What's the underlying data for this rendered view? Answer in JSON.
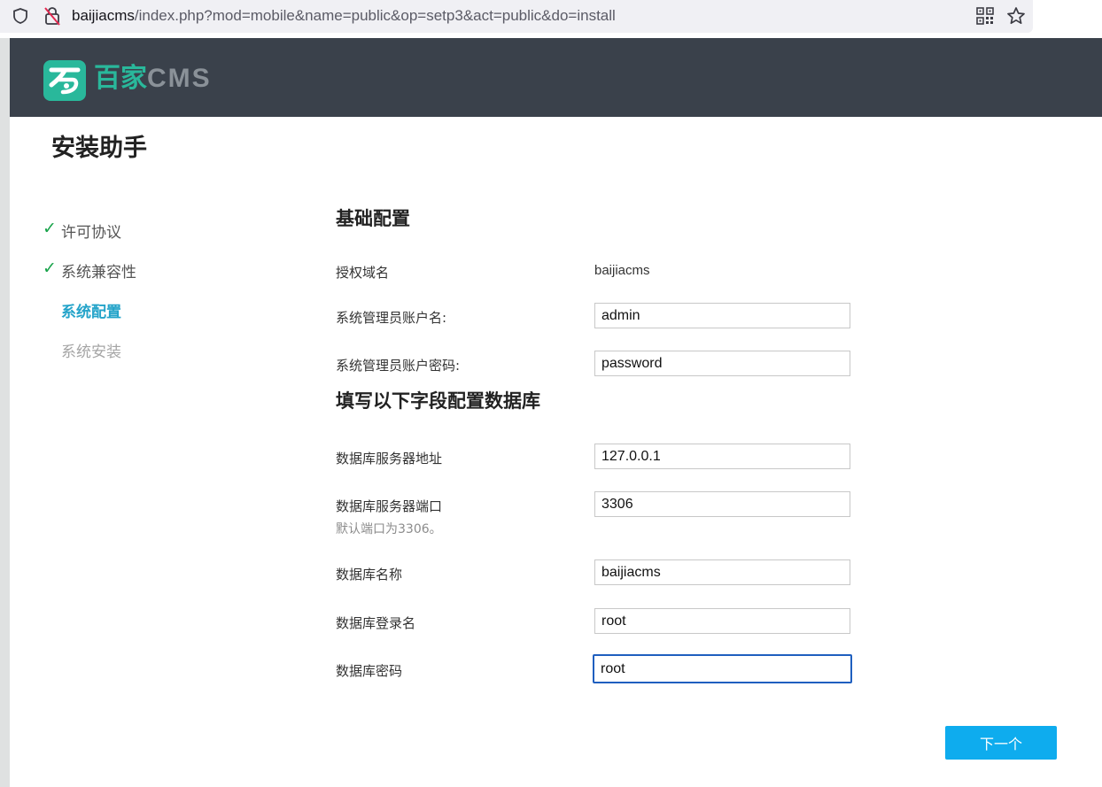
{
  "browser": {
    "url_host": "baijiacms",
    "url_path": "/index.php?mod=mobile&name=public&op=setp3&act=public&do=install"
  },
  "header": {
    "logo_cn": "百家",
    "logo_en": "CMS",
    "brand_color": "#29b89b",
    "background": "#3a414b"
  },
  "page": {
    "title": "安装助手"
  },
  "steps": [
    {
      "label": "许可协议",
      "state": "done"
    },
    {
      "label": "系统兼容性",
      "state": "done"
    },
    {
      "label": "系统配置",
      "state": "current"
    },
    {
      "label": "系统安装",
      "state": "pending"
    }
  ],
  "basic": {
    "section_title": "基础配置",
    "domain_label": "授权域名",
    "domain_value": "baijiacms",
    "admin_user_label": "系统管理员账户名:",
    "admin_user_value": "admin",
    "admin_pass_label": "系统管理员账户密码:",
    "admin_pass_value": "password"
  },
  "database": {
    "section_title": "填写以下字段配置数据库",
    "host_label": "数据库服务器地址",
    "host_value": "127.0.0.1",
    "port_label": "数据库服务器端口",
    "port_value": "3306",
    "port_hint": "默认端口为3306。",
    "name_label": "数据库名称",
    "name_value": "baijiacms",
    "user_label": "数据库登录名",
    "user_value": "root",
    "pass_label": "数据库密码",
    "pass_value": "root"
  },
  "actions": {
    "next_label": "下一个",
    "accent": "#0eacee"
  }
}
